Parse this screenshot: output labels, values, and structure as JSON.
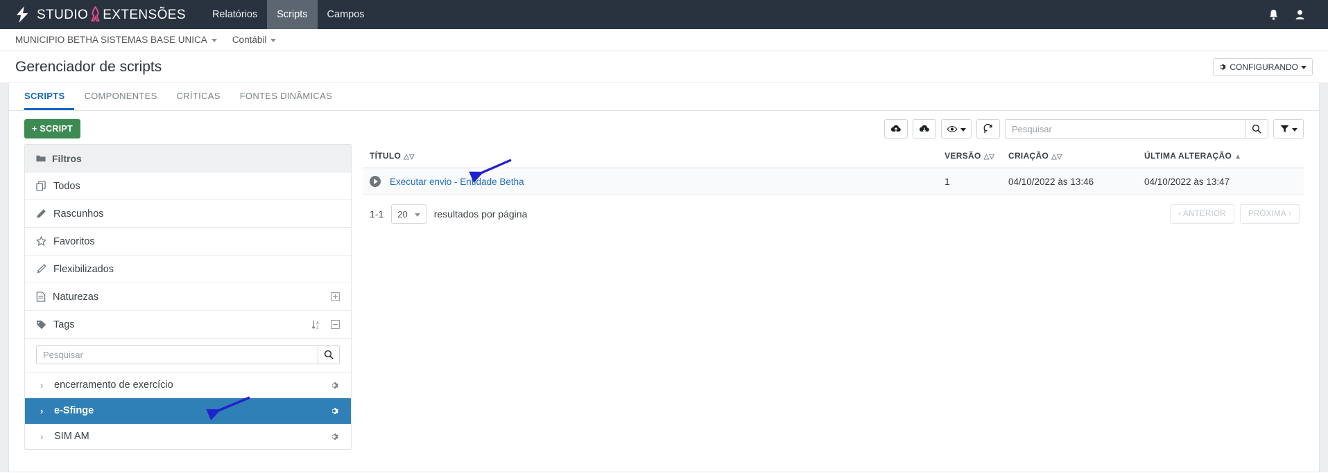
{
  "navbar": {
    "brand_studio": "STUDIO",
    "brand_ext": "EXTENSÕES",
    "logo_icon": "lightning-bolt-icon",
    "ribbon_icon": "pink-ribbon-icon",
    "items": [
      {
        "label": "Relatórios",
        "active": false
      },
      {
        "label": "Scripts",
        "active": true
      },
      {
        "label": "Campos",
        "active": false
      }
    ],
    "right_icons": [
      {
        "name": "bell-icon"
      },
      {
        "name": "user-icon"
      }
    ]
  },
  "breadcrumb": {
    "entity": "MUNICIPIO BETHA SISTEMAS BASE UNICA",
    "module": "Contábil"
  },
  "page": {
    "title": "Gerenciador de scripts",
    "config_button": "CONFIGURANDO",
    "config_icon": "gear-icon"
  },
  "tabs": [
    {
      "label": "SCRIPTS",
      "active": true
    },
    {
      "label": "COMPONENTES",
      "active": false
    },
    {
      "label": "CRÍTICAS",
      "active": false
    },
    {
      "label": "FONTES DINÂMICAS",
      "active": false
    }
  ],
  "toolbar": {
    "new_script_label": "+ SCRIPT",
    "new_script_color": "#3d8b52",
    "icons": [
      {
        "name": "cloud-upload-icon"
      },
      {
        "name": "cloud-download-icon"
      },
      {
        "name": "eye-dropdown-icon"
      },
      {
        "name": "refresh-icon"
      }
    ],
    "search_placeholder": "Pesquisar",
    "search_value": "",
    "search_icon": "search-icon",
    "filter_icon": "funnel-dropdown-icon"
  },
  "sidebar": {
    "header": {
      "label": "Filtros",
      "icon": "folder-icon"
    },
    "items": [
      {
        "label": "Todos",
        "icon": "copy-icon",
        "action": null
      },
      {
        "label": "Rascunhos",
        "icon": "pencil-icon",
        "action": null
      },
      {
        "label": "Favoritos",
        "icon": "star-icon",
        "action": null
      },
      {
        "label": "Flexibilizados",
        "icon": "magic-wand-icon",
        "action": null
      },
      {
        "label": "Naturezas",
        "icon": "document-icon",
        "action": "plus-square-icon"
      },
      {
        "label": "Tags",
        "icon": "tag-icon",
        "action": "sort-alpha-icon|minus-square-icon"
      }
    ],
    "tag_search_placeholder": "Pesquisar",
    "tag_search_value": "",
    "tags": [
      {
        "label": "encerramento de exercício",
        "selected": false,
        "chevron": "chevron-right-icon",
        "gear": "gear-icon"
      },
      {
        "label": "e-Sfinge",
        "selected": true,
        "chevron": "chevron-right-icon",
        "gear": "gear-icon"
      },
      {
        "label": "SIM AM",
        "selected": false,
        "chevron": "chevron-right-icon",
        "gear": "gear-icon"
      }
    ],
    "selected_color": "#3080b8"
  },
  "table": {
    "columns": [
      {
        "label": "TÍTULO",
        "sort": "both"
      },
      {
        "label": "VERSÃO",
        "sort": "both"
      },
      {
        "label": "CRIAÇÃO",
        "sort": "both"
      },
      {
        "label": "ÚLTIMA ALTERAÇÃO",
        "sort": "asc"
      }
    ],
    "rows": [
      {
        "play_icon": "play-circle-icon",
        "titulo": "Executar envio - Entidade Betha",
        "versao": "1",
        "criacao": "04/10/2022 às 13:46",
        "ultima_alteracao": "04/10/2022 às 13:47"
      }
    ]
  },
  "pagination": {
    "range": "1-1",
    "per_page_value": "20",
    "per_page_label": "resultados por página",
    "prev_label": "‹ ANTERIOR",
    "next_label": "PRÓXIMA ›"
  },
  "annotations": {
    "arrow_color": "#2222cc",
    "arrows": [
      {
        "name": "arrow-pointing-to-script-row"
      },
      {
        "name": "arrow-pointing-to-esfinge-tag"
      }
    ]
  }
}
